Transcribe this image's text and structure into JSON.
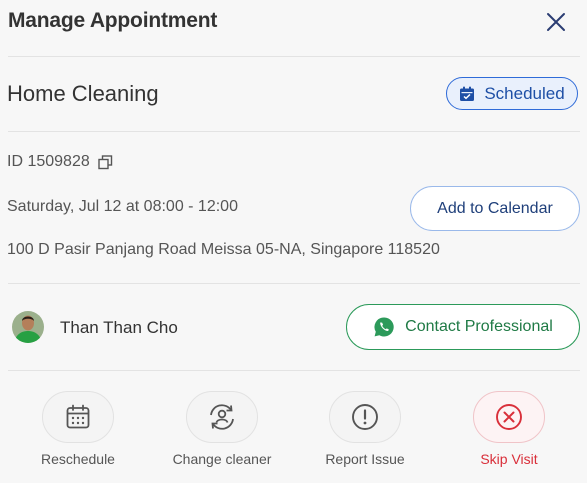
{
  "header": {
    "title": "Manage Appointment"
  },
  "appointment": {
    "service": "Home Cleaning",
    "status": "Scheduled",
    "id_text": "ID 1509828",
    "datetime": "Saturday, Jul 12 at 08:00 - 12:00",
    "address": "100 D Pasir Panjang Road Meissa 05-NA, Singapore 118520",
    "add_calendar_label": "Add to Calendar"
  },
  "professional": {
    "name": "Than Than Cho",
    "contact_label": "Contact Professional"
  },
  "actions": [
    {
      "label": "Reschedule",
      "icon": "calendar-icon"
    },
    {
      "label": "Change cleaner",
      "icon": "swap-person-icon"
    },
    {
      "label": "Report Issue",
      "icon": "exclamation-icon"
    },
    {
      "label": "Skip Visit",
      "icon": "x-circle-icon"
    }
  ],
  "colors": {
    "accent_blue": "#2f6bd8",
    "whatsapp_green": "#2c9a5a",
    "danger_red": "#d92f3a"
  }
}
